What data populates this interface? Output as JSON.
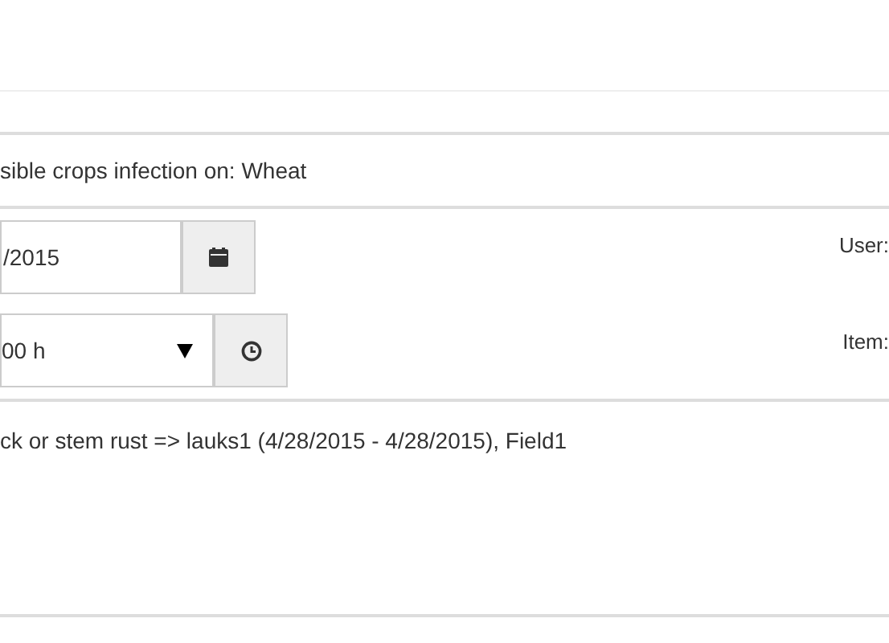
{
  "header": {
    "title": "sible crops infection on: Wheat"
  },
  "date_field": {
    "value": "/2015"
  },
  "time_select": {
    "value": "00 h"
  },
  "labels": [
    "User:",
    "Item:"
  ],
  "result": {
    "text": "ck or stem rust => lauks1 (4/28/2015 - 4/28/2015), Field1"
  }
}
